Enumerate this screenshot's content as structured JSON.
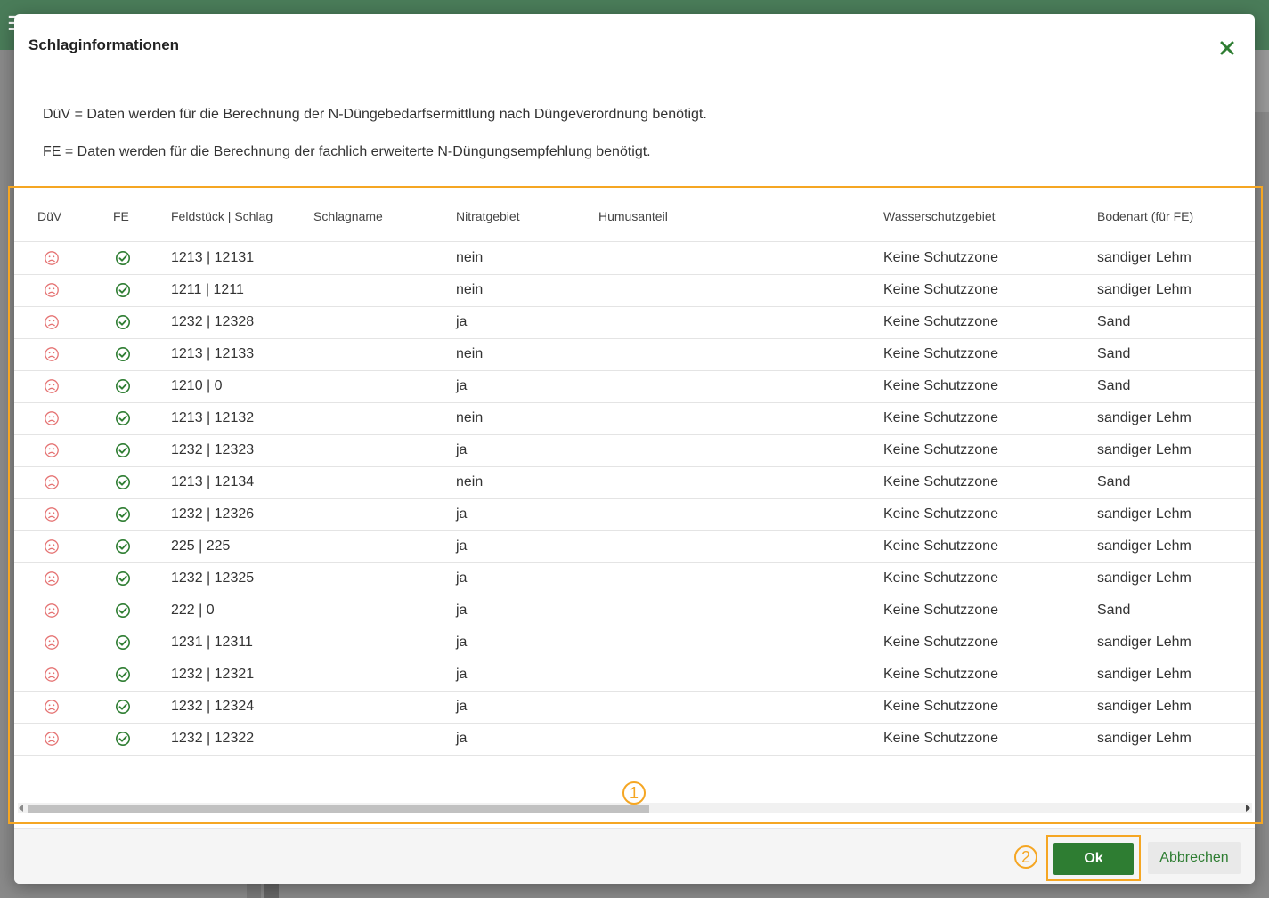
{
  "dialog": {
    "title": "Schlaginformationen",
    "info_duev": "DüV = Daten werden für die Berechnung der N-Düngebedarfsermittlung nach Düngeverordnung benötigt.",
    "info_fe": "FE = Daten werden für die Berechnung der fachlich erweiterte N-Düngungsempfehlung benötigt."
  },
  "table": {
    "columns": [
      "DüV",
      "FE",
      "Feldstück | Schlag",
      "Schlagname",
      "Nitratgebiet",
      "Humusanteil",
      "Wasserschutzgebiet",
      "Bodenart (für FE)"
    ],
    "rows": [
      {
        "duev": "sad",
        "fe": "check",
        "feld": "1213 | 12131",
        "name": "",
        "nitrat": "nein",
        "humus": "",
        "wasser": "Keine Schutzzone",
        "boden": "sandiger Lehm"
      },
      {
        "duev": "sad",
        "fe": "check",
        "feld": "1211 | 1211",
        "name": "",
        "nitrat": "nein",
        "humus": "",
        "wasser": "Keine Schutzzone",
        "boden": "sandiger Lehm"
      },
      {
        "duev": "sad",
        "fe": "check",
        "feld": "1232 | 12328",
        "name": "",
        "nitrat": "ja",
        "humus": "",
        "wasser": "Keine Schutzzone",
        "boden": "Sand"
      },
      {
        "duev": "sad",
        "fe": "check",
        "feld": "1213 | 12133",
        "name": "",
        "nitrat": "nein",
        "humus": "",
        "wasser": "Keine Schutzzone",
        "boden": "Sand"
      },
      {
        "duev": "sad",
        "fe": "check",
        "feld": "1210 | 0",
        "name": "",
        "nitrat": "ja",
        "humus": "",
        "wasser": "Keine Schutzzone",
        "boden": "Sand"
      },
      {
        "duev": "sad",
        "fe": "check",
        "feld": "1213 | 12132",
        "name": "",
        "nitrat": "nein",
        "humus": "",
        "wasser": "Keine Schutzzone",
        "boden": "sandiger Lehm"
      },
      {
        "duev": "sad",
        "fe": "check",
        "feld": "1232 | 12323",
        "name": "",
        "nitrat": "ja",
        "humus": "",
        "wasser": "Keine Schutzzone",
        "boden": "sandiger Lehm"
      },
      {
        "duev": "sad",
        "fe": "check",
        "feld": "1213 | 12134",
        "name": "",
        "nitrat": "nein",
        "humus": "",
        "wasser": "Keine Schutzzone",
        "boden": "Sand"
      },
      {
        "duev": "sad",
        "fe": "check",
        "feld": "1232 | 12326",
        "name": "",
        "nitrat": "ja",
        "humus": "",
        "wasser": "Keine Schutzzone",
        "boden": "sandiger Lehm"
      },
      {
        "duev": "sad",
        "fe": "check",
        "feld": "225 | 225",
        "name": "",
        "nitrat": "ja",
        "humus": "",
        "wasser": "Keine Schutzzone",
        "boden": "sandiger Lehm"
      },
      {
        "duev": "sad",
        "fe": "check",
        "feld": "1232 | 12325",
        "name": "",
        "nitrat": "ja",
        "humus": "",
        "wasser": "Keine Schutzzone",
        "boden": "sandiger Lehm"
      },
      {
        "duev": "sad",
        "fe": "check",
        "feld": "222 | 0",
        "name": "",
        "nitrat": "ja",
        "humus": "",
        "wasser": "Keine Schutzzone",
        "boden": "Sand"
      },
      {
        "duev": "sad",
        "fe": "check",
        "feld": "1231 | 12311",
        "name": "",
        "nitrat": "ja",
        "humus": "",
        "wasser": "Keine Schutzzone",
        "boden": "sandiger Lehm"
      },
      {
        "duev": "sad",
        "fe": "check",
        "feld": "1232 | 12321",
        "name": "",
        "nitrat": "ja",
        "humus": "",
        "wasser": "Keine Schutzzone",
        "boden": "sandiger Lehm"
      },
      {
        "duev": "sad",
        "fe": "check",
        "feld": "1232 | 12324",
        "name": "",
        "nitrat": "ja",
        "humus": "",
        "wasser": "Keine Schutzzone",
        "boden": "sandiger Lehm"
      },
      {
        "duev": "sad",
        "fe": "check",
        "feld": "1232 | 12322",
        "name": "",
        "nitrat": "ja",
        "humus": "",
        "wasser": "Keine Schutzzone",
        "boden": "sandiger Lehm"
      }
    ],
    "horizontal_scroll_fraction_visible": 0.5
  },
  "footer": {
    "ok_label": "Ok",
    "cancel_label": "Abbrechen"
  },
  "annotations": {
    "marker_1": "1",
    "marker_2": "2"
  },
  "icons": {
    "duev_status": "sad-face-icon",
    "fe_status": "check-circle-icon",
    "close": "close-icon",
    "menu": "menu-icon"
  },
  "colors": {
    "topbar": "#4a7c59",
    "primary_green": "#2e7d32",
    "sad_red": "#e57373",
    "annotation_orange": "#f5a623"
  }
}
